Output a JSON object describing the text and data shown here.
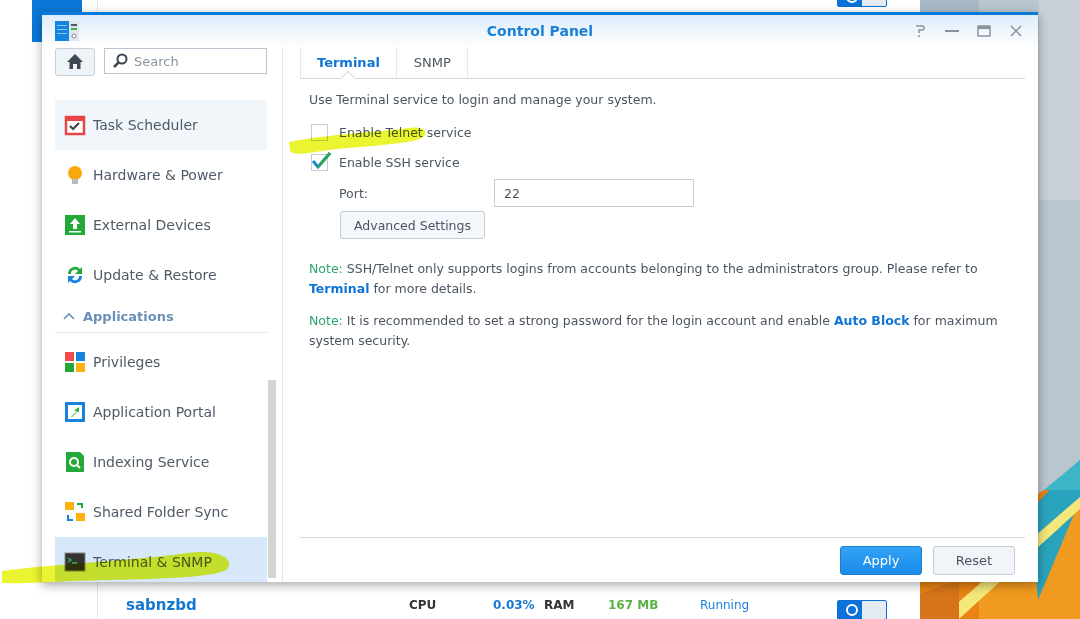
{
  "background_window": {
    "rows": [
      {
        "on": true
      },
      {
        "name": "sabnzbd",
        "cpu_label": "CPU",
        "cpu": "0.03%",
        "ram_label": "RAM",
        "ram": "167 MB",
        "status": "Running",
        "on": true
      }
    ]
  },
  "window": {
    "title": "Control Panel"
  },
  "sidebar": {
    "search": {
      "placeholder": "Search"
    },
    "items": [
      {
        "kind": "item",
        "label": "Task Scheduler",
        "selected": false,
        "hover": true
      },
      {
        "kind": "item",
        "label": "Hardware & Power",
        "selected": false,
        "hover": false
      },
      {
        "kind": "item",
        "label": "External Devices",
        "selected": false,
        "hover": false
      },
      {
        "kind": "item",
        "label": "Update & Restore",
        "selected": false,
        "hover": false
      },
      {
        "kind": "header",
        "label": "Applications",
        "expanded": true
      },
      {
        "kind": "item",
        "label": "Privileges",
        "selected": false,
        "hover": false
      },
      {
        "kind": "item",
        "label": "Application Portal",
        "selected": false,
        "hover": false
      },
      {
        "kind": "item",
        "label": "Indexing Service",
        "selected": false,
        "hover": false
      },
      {
        "kind": "item",
        "label": "Shared Folder Sync",
        "selected": false,
        "hover": false
      },
      {
        "kind": "item",
        "label": "Terminal & SNMP",
        "selected": true,
        "hover": false
      }
    ]
  },
  "tabs": [
    {
      "label": "Terminal",
      "selected": true
    },
    {
      "label": "SNMP",
      "selected": false
    }
  ],
  "content": {
    "intro": "Use Terminal service to login and manage your system.",
    "options": [
      {
        "label": "Enable Telnet service",
        "checked": false
      },
      {
        "label": "Enable SSH service",
        "checked": true
      }
    ],
    "port": {
      "label": "Port:",
      "value": "22"
    },
    "advanced_button": "Advanced Settings",
    "notes": [
      {
        "prefix": "Note:",
        "before": " SSH/Telnet only supports logins from accounts belonging to the administrators group. Please refer to ",
        "link": "Terminal",
        "after": " for more details."
      },
      {
        "prefix": "Note:",
        "before": " It is recommended to set a strong password for the login account and enable ",
        "link": "Auto Block",
        "after": " for maximum system security."
      }
    ]
  },
  "buttons": [
    {
      "label": "Apply",
      "kind": "primary"
    },
    {
      "label": "Reset",
      "kind": "default"
    }
  ]
}
